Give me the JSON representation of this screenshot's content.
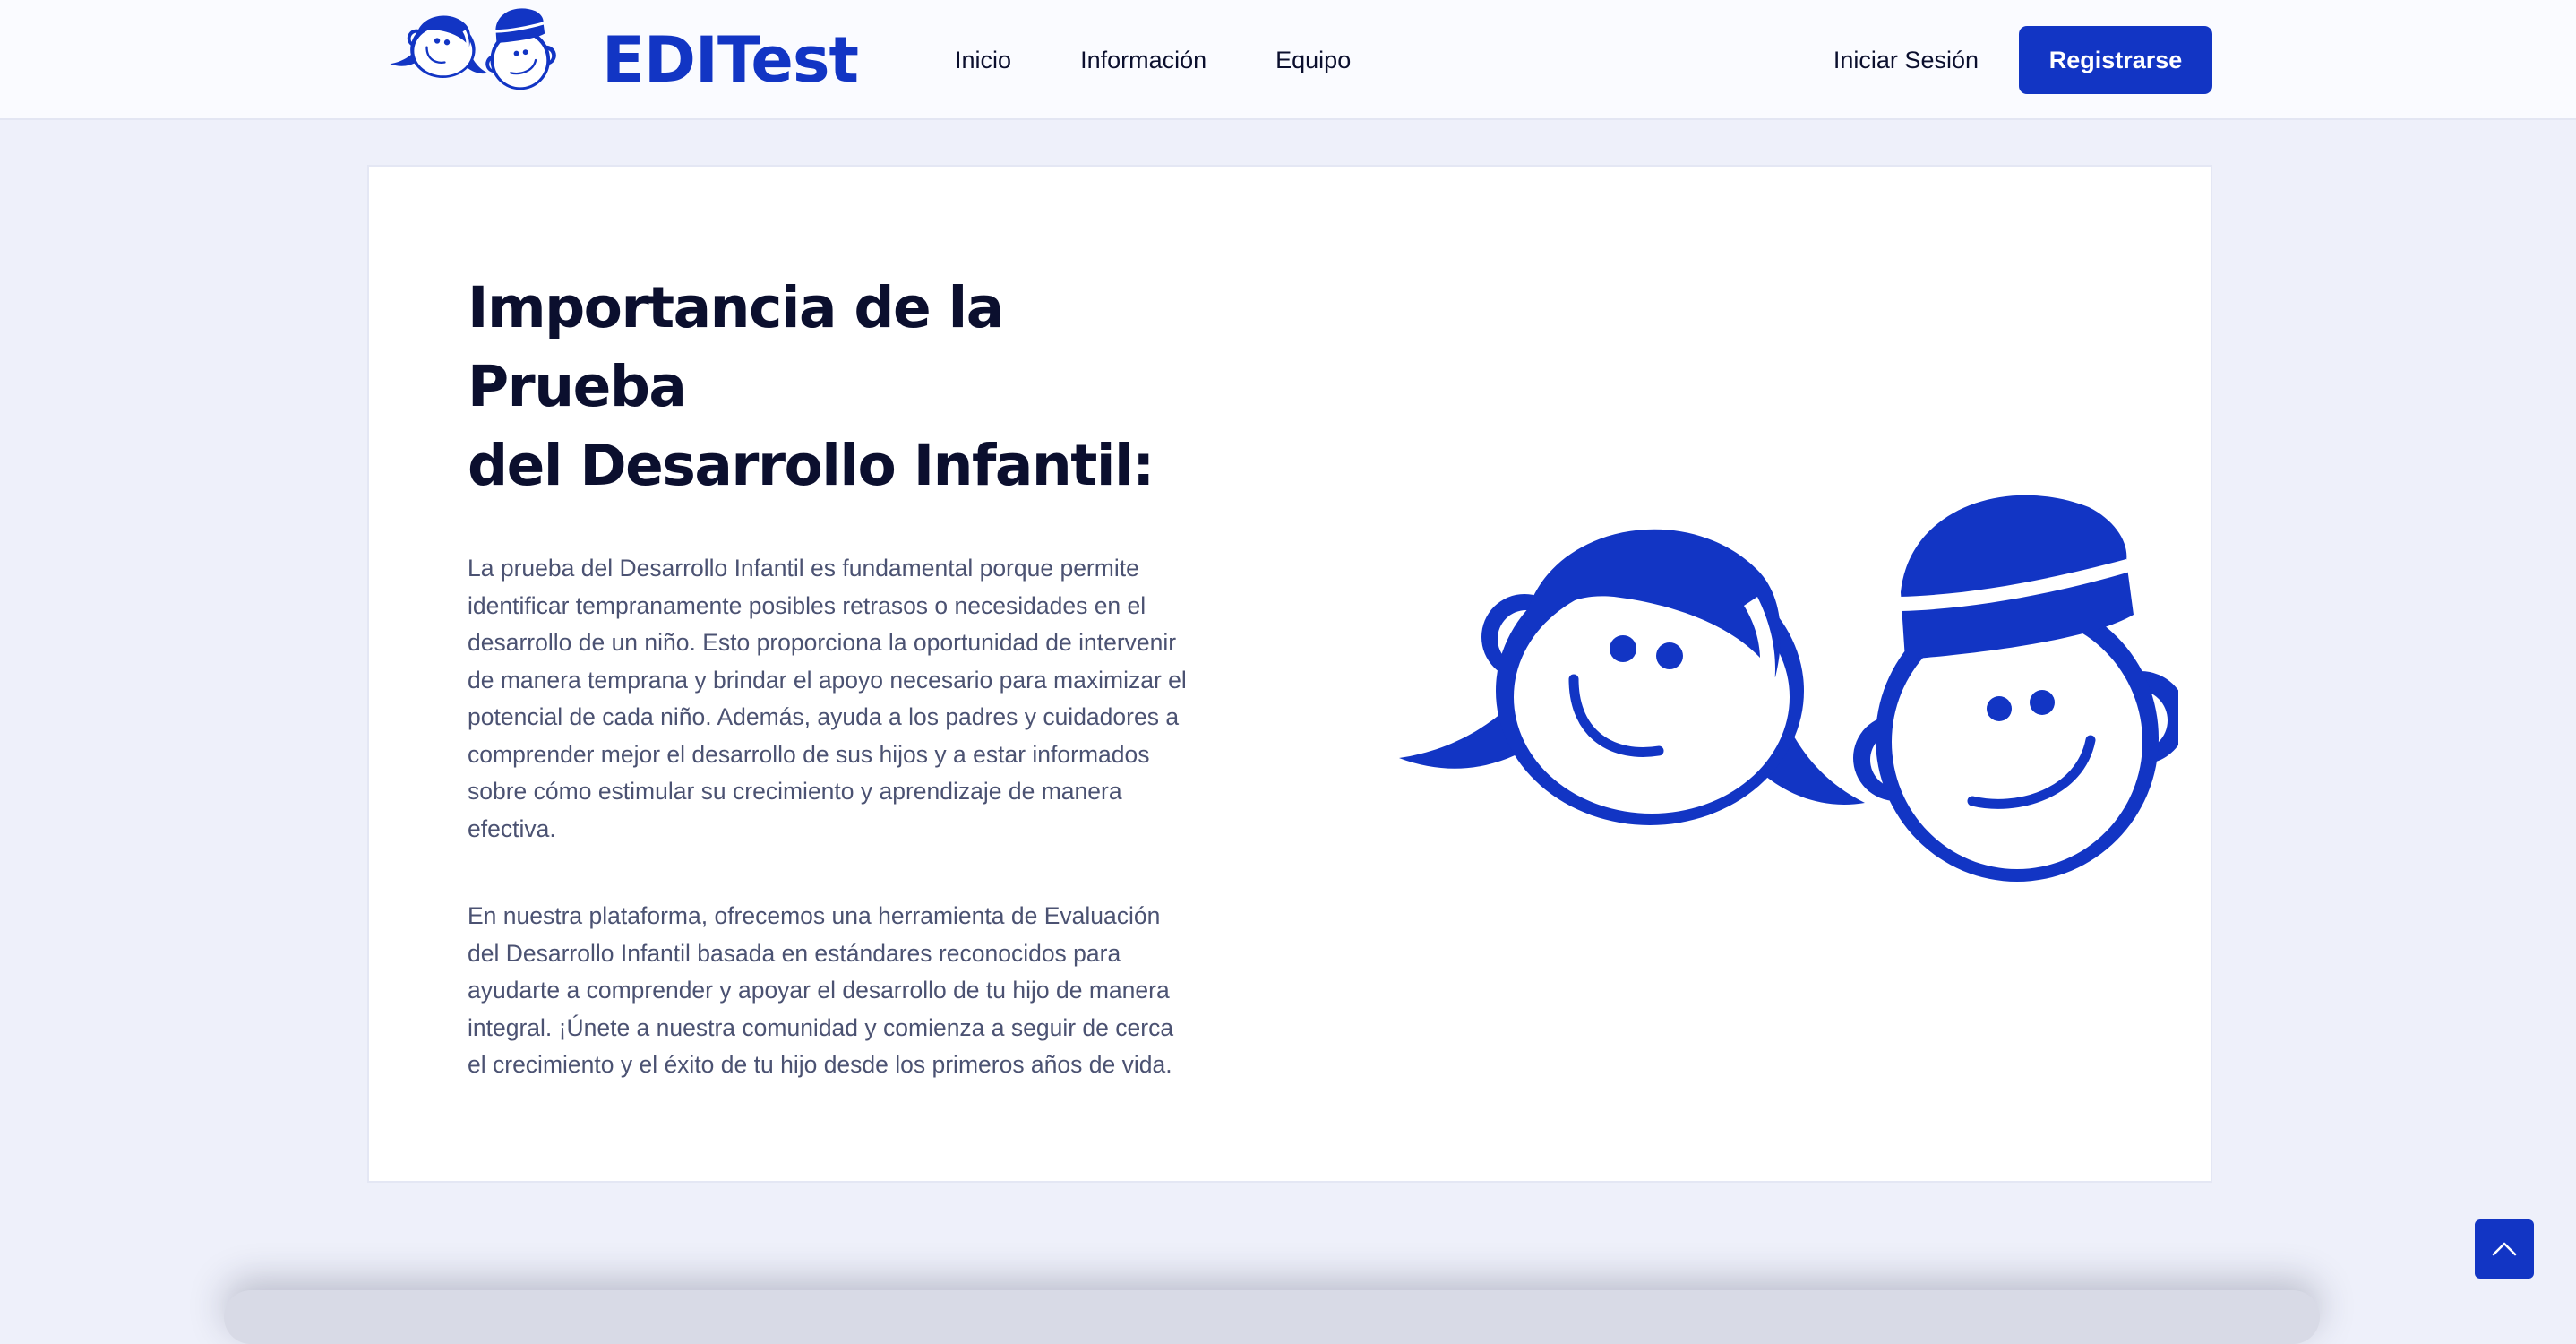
{
  "brand": {
    "name": "EDITest",
    "logo_icon": "children-faces-logo"
  },
  "nav": {
    "items": [
      {
        "label": "Inicio"
      },
      {
        "label": "Información"
      },
      {
        "label": "Equipo"
      }
    ]
  },
  "header_actions": {
    "login_label": "Iniciar Sesión",
    "register_label": "Registrarse"
  },
  "main": {
    "title_line1": "Importancia de la Prueba",
    "title_line2": "del Desarrollo Infantil:",
    "paragraph1": "La prueba del Desarrollo Infantil es fundamental porque permite identificar tempranamente posibles retrasos o necesidades en el desarrollo de un niño. Esto proporciona la oportunidad de intervenir de manera temprana y brindar el apoyo necesario para maximizar el potencial de cada niño. Además, ayuda a los padres y cuidadores a comprender mejor el desarrollo de sus hijos y a estar informados sobre cómo estimular su crecimiento y aprendizaje de manera efectiva.",
    "paragraph2": "En nuestra plataforma, ofrecemos una herramienta de Evaluación del Desarrollo Infantil basada en estándares reconocidos para ayudarte a comprender y apoyar el desarrollo de tu hijo de manera integral. ¡Únete a nuestra comunidad y comienza a seguir de cerca el crecimiento y el éxito de tu hijo desde los primeros años de vida.",
    "illustration_icon": "children-faces-illustration"
  },
  "scroll_top_icon": "chevron-up-icon",
  "colors": {
    "accent": "#1235c4",
    "page_background": "#eef0fa",
    "header_background": "#fafbff",
    "heading_text": "#0b0f2e",
    "body_text": "#4b5272"
  }
}
